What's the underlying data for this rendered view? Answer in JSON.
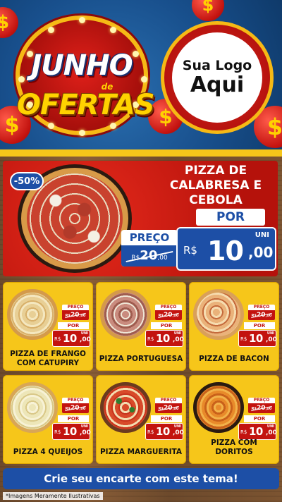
{
  "header": {
    "title_line1": "JUNHO",
    "title_de": "de",
    "title_line2": "OFERTAS",
    "logo_line1": "Sua Logo",
    "logo_line2": "Aqui",
    "coin_symbol": "$"
  },
  "hero": {
    "discount_badge": "-50%",
    "product_name": "PIZZA DE CALABRESA E CEBOLA",
    "old_label": "PREÇO",
    "old_currency": "R$",
    "old_int": "20",
    "old_dec": ",00",
    "por_label": "POR",
    "currency": "R$",
    "price_int": "10",
    "price_dec": ",00",
    "unit": "UNI"
  },
  "products": [
    {
      "name": "PIZZA DE FRANGO COM CATUPIRY",
      "old_label": "PREÇO",
      "old_currency": "R$",
      "old_int": "20",
      "old_dec": ",00",
      "por_label": "POR",
      "currency": "R$",
      "price_int": "10",
      "price_dec": ",00",
      "unit": "UNI"
    },
    {
      "name": "PIZZA PORTUGUESA",
      "old_label": "PREÇO",
      "old_currency": "R$",
      "old_int": "20",
      "old_dec": ",00",
      "por_label": "POR",
      "currency": "R$",
      "price_int": "10",
      "price_dec": ",00",
      "unit": "UNI"
    },
    {
      "name": "PIZZA DE BACON",
      "old_label": "PREÇO",
      "old_currency": "R$",
      "old_int": "20",
      "old_dec": ",00",
      "por_label": "POR",
      "currency": "R$",
      "price_int": "10",
      "price_dec": ",00",
      "unit": "UNI"
    },
    {
      "name": "PIZZA 4 QUEIJOS",
      "old_label": "PREÇO",
      "old_currency": "R$",
      "old_int": "20",
      "old_dec": ",00",
      "por_label": "POR",
      "currency": "R$",
      "price_int": "10",
      "price_dec": ",00",
      "unit": "UNI"
    },
    {
      "name": "PIZZA MARGUERITA",
      "old_label": "PREÇO",
      "old_currency": "R$",
      "old_int": "20",
      "old_dec": ",00",
      "por_label": "POR",
      "currency": "R$",
      "price_int": "10",
      "price_dec": ",00",
      "unit": "UNI"
    },
    {
      "name": "PIZZA COM DORITOS",
      "old_label": "PREÇO",
      "old_currency": "R$",
      "old_int": "20",
      "old_dec": ",00",
      "por_label": "POR",
      "currency": "R$",
      "price_int": "10",
      "price_dec": ",00",
      "unit": "UNI"
    }
  ],
  "cta": {
    "label": "Crie seu encarte com este tema!"
  },
  "footer": {
    "disclaimer": "*Imagens Meramente Ilustrativas"
  },
  "colors": {
    "brand_blue": "#1d4fa6",
    "brand_red": "#c3130f",
    "brand_yellow": "#f6c61a",
    "gold": "#ffd200"
  }
}
